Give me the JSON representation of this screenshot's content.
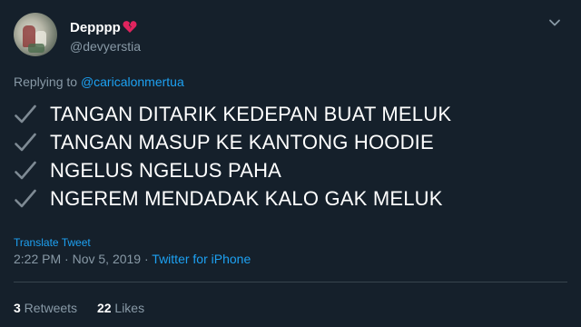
{
  "author": {
    "display_name": "Depppp",
    "name_emoji_icon": "broken-heart-icon",
    "handle": "@devyerstia"
  },
  "reply": {
    "prefix": "Replying to ",
    "mention": "@caricalonmertua"
  },
  "body": {
    "bullet_icon": "check-icon",
    "lines": [
      "TANGAN DITARIK KEDEPAN BUAT MELUK",
      "TANGAN MASUP KE KANTONG HOODIE",
      "NGELUS NGELUS PAHA",
      "NGEREM MENDADAK KALO GAK MELUK"
    ]
  },
  "translate_label": "Translate Tweet",
  "meta": {
    "time": "2:22 PM",
    "sep1": " · ",
    "date": "Nov 5, 2019",
    "sep2": " · ",
    "source": "Twitter for iPhone"
  },
  "stats": {
    "retweets_count": "3",
    "retweets_label": " Retweets",
    "likes_count": "22",
    "likes_label": " Likes"
  },
  "colors": {
    "background": "#15202b",
    "link": "#1da1f2",
    "secondary_text": "#8899a6",
    "heart": "#e0245e"
  }
}
